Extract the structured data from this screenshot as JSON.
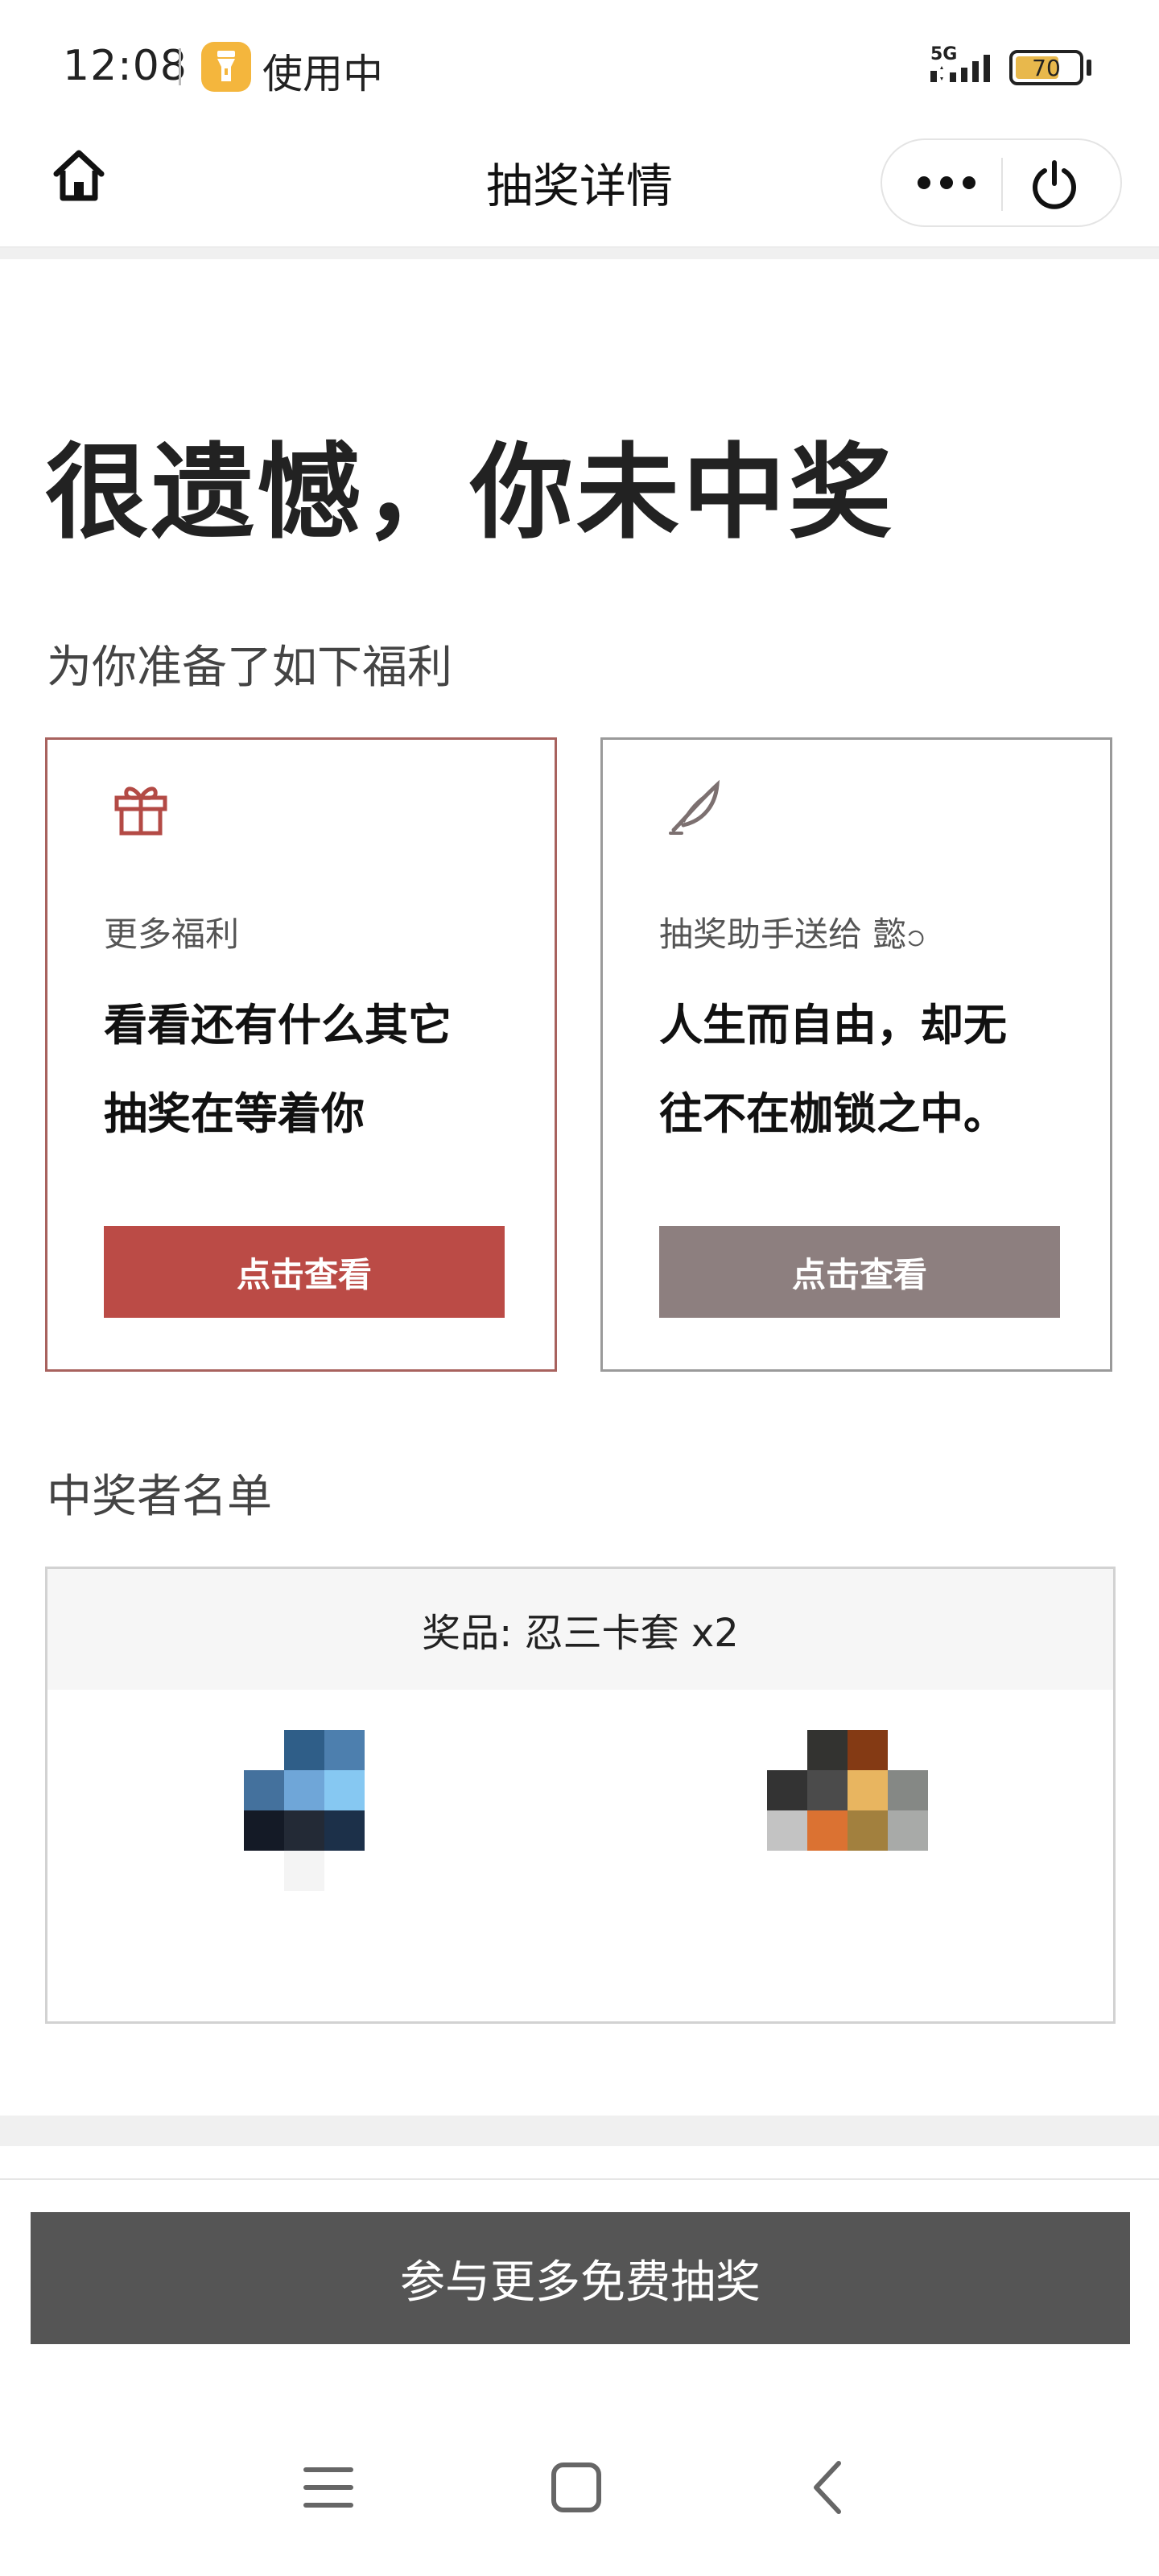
{
  "status_bar": {
    "time": "12:08",
    "app_label": "使用中",
    "app_icon": "flashlight-icon",
    "network": "5G",
    "battery": "70",
    "battery_level": 0.7
  },
  "nav": {
    "title": "抽奖详情",
    "home_icon": "home-icon",
    "more_icon": "more-icon",
    "power_icon": "power-icon"
  },
  "result": {
    "title": "很遗憾，你未中奖"
  },
  "benefits": {
    "section_label": "为你准备了如下福利",
    "cards": [
      {
        "icon": "gift-icon",
        "label": "更多福利",
        "lines": [
          "看看还有什么其它",
          "抽奖在等着你"
        ],
        "button": "点击查看"
      },
      {
        "icon": "feather-icon",
        "label": "抽奖助手送给 懿၁",
        "lines": [
          "人生而自由，却无",
          "往不在枷锁之中。"
        ],
        "button": "点击查看"
      }
    ]
  },
  "winners": {
    "section_label": "中奖者名单",
    "prize_text": "奖品:  忍三卡套 x2"
  },
  "footer": {
    "button": "参与更多免费抽奖"
  },
  "colors": {
    "accent_red": "#bb4b46",
    "muted_button": "#8d7f7f",
    "bottom_button": "#555555"
  }
}
